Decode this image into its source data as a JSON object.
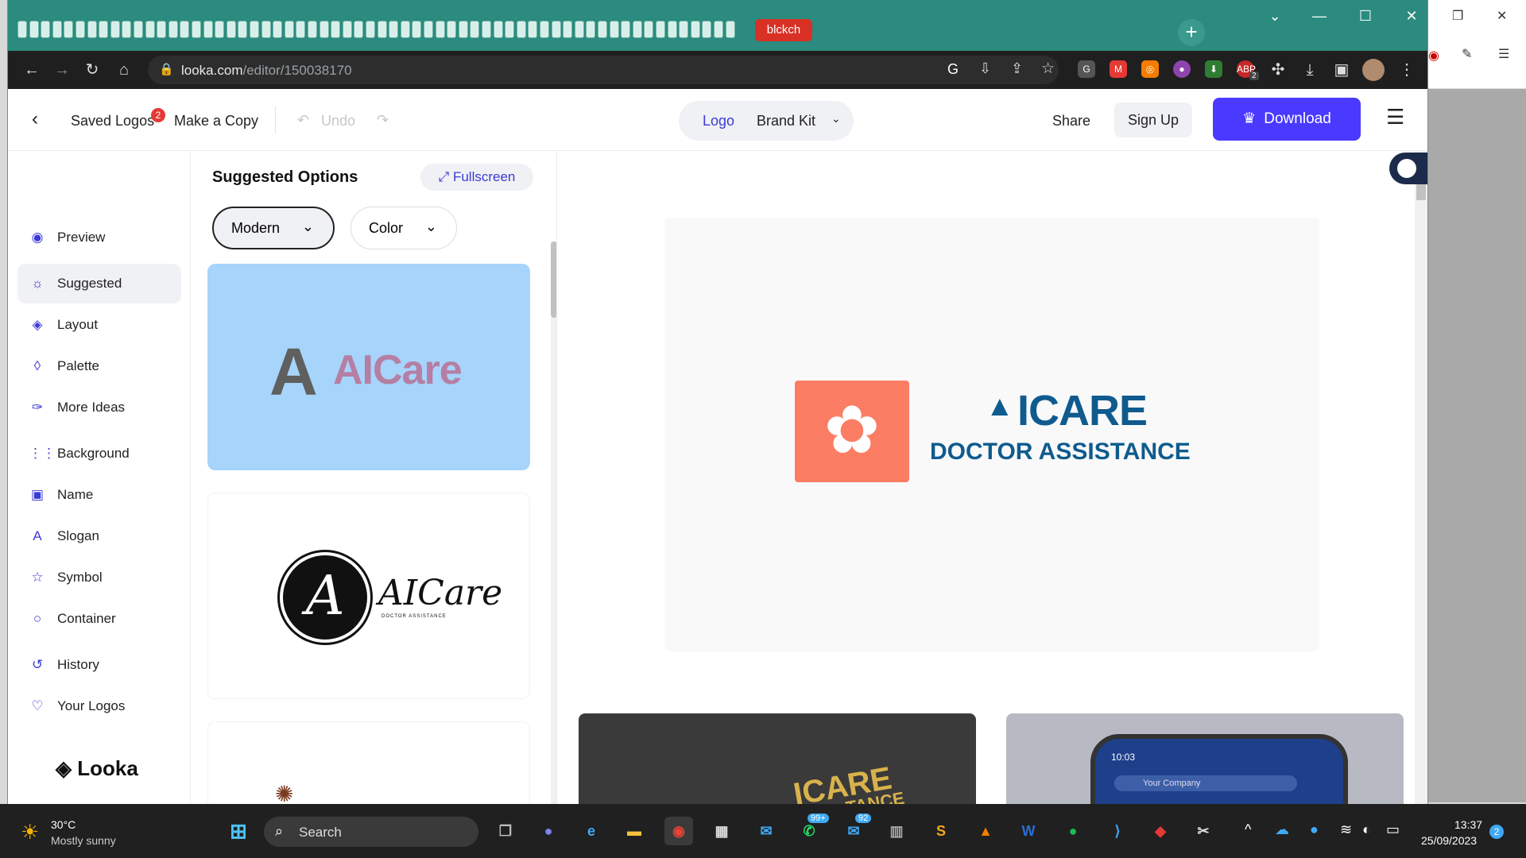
{
  "browser": {
    "active_tab_label": "blckch",
    "url_domain": "looka.com",
    "url_path": "/editor/150038170",
    "ext_badge": "2"
  },
  "header": {
    "saved_logos": "Saved Logos",
    "saved_badge": "2",
    "make_copy": "Make a Copy",
    "undo": "Undo",
    "tab_logo": "Logo",
    "tab_brand_kit": "Brand Kit",
    "share": "Share",
    "sign_up": "Sign Up",
    "download": "Download"
  },
  "sidebar": {
    "items": [
      {
        "label": "Preview",
        "icon": "eye-icon"
      },
      {
        "label": "Suggested",
        "icon": "lightbulb-icon"
      },
      {
        "label": "Layout",
        "icon": "layers-icon"
      },
      {
        "label": "Palette",
        "icon": "drop-icon"
      },
      {
        "label": "More Ideas",
        "icon": "pin-icon"
      },
      {
        "label": "Background",
        "icon": "grid-icon"
      },
      {
        "label": "Name",
        "icon": "text-box-icon"
      },
      {
        "label": "Slogan",
        "icon": "font-icon"
      },
      {
        "label": "Symbol",
        "icon": "star-icon"
      },
      {
        "label": "Container",
        "icon": "circle-icon"
      },
      {
        "label": "History",
        "icon": "history-icon"
      },
      {
        "label": "Your Logos",
        "icon": "heart-icon"
      }
    ],
    "brand": "Looka"
  },
  "suggestions": {
    "title": "Suggested Options",
    "fullscreen": "Fullscreen",
    "filter_style": "Modern",
    "filter_color": "Color",
    "card1": {
      "mark": "A",
      "name": "AICare",
      "bg": "#a6d4fb",
      "name_color": "#b57fa3"
    },
    "card2": {
      "mark": "A",
      "name": "AICare",
      "tagline": "DOCTOR ASSISTANCE"
    }
  },
  "preview": {
    "name": "ICARE",
    "tagline": "DOCTOR ASSISTANCE",
    "icon_bg": "#fb7d63",
    "text_color": "#0f5b8e",
    "mock_name": "ICARE",
    "mock_tagline": "TANCE",
    "phone_time": "10:03",
    "phone_search": "Your Company"
  },
  "taskbar": {
    "weather_temp": "30°C",
    "weather_desc": "Mostly sunny",
    "search": "Search",
    "whatsapp_badge": "99+",
    "outlook_badge": "92",
    "time": "13:37",
    "date": "25/09/2023",
    "notif": "2"
  }
}
